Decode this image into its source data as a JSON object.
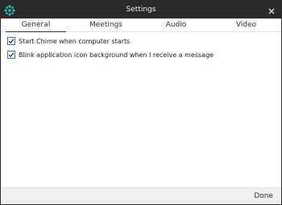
{
  "window": {
    "title": "Settings"
  },
  "tabs": [
    {
      "label": "General",
      "active": true
    },
    {
      "label": "Meetings",
      "active": false
    },
    {
      "label": "Audio",
      "active": false
    },
    {
      "label": "Video",
      "active": false
    }
  ],
  "general": {
    "options": [
      {
        "label": "Start Chime when computer starts",
        "checked": true
      },
      {
        "label": "Blink application icon background when I receive a message",
        "checked": true
      }
    ]
  },
  "footer": {
    "done_label": "Done"
  },
  "icons": {
    "app": "chime-logo-icon",
    "close": "close-icon",
    "check": "checkmark-icon"
  },
  "colors": {
    "titlebar": "#2a2a2a",
    "accent": "#3f6fb7",
    "logo": "#2bb9b4"
  }
}
